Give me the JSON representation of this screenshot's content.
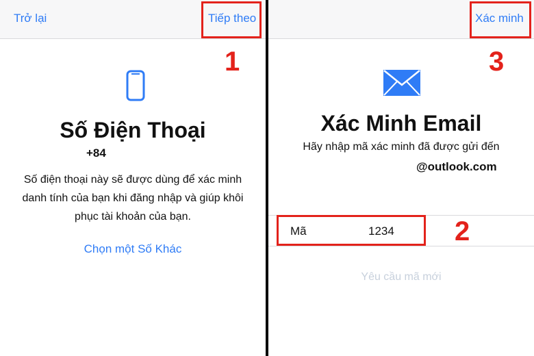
{
  "left": {
    "back_label": "Trở lại",
    "next_label": "Tiếp theo",
    "title": "Số Điện Thoại",
    "phone_prefix": "+84",
    "description_line1": "Số điện thoại này sẽ được dùng để xác minh",
    "description_line2": "danh tính của bạn khi đăng nhập và giúp khôi",
    "description_line3": "phục tài khoản của bạn.",
    "choose_other_link": "Chọn một Số Khác",
    "step_marker": "1"
  },
  "right": {
    "verify_label": "Xác minh",
    "title": "Xác Minh Email",
    "subtitle": "Hãy nhập mã xác minh đã được gửi đến",
    "email_domain": "@outlook.com",
    "code_label": "Mã",
    "code_value": "1234",
    "resend_link": "Yêu cầu mã mới",
    "step_marker_2": "2",
    "step_marker_3": "3"
  },
  "colors": {
    "accent": "#2f7cf6",
    "highlight": "#e3221b"
  },
  "icons": {
    "phone": "phone-icon",
    "mail": "mail-icon"
  }
}
